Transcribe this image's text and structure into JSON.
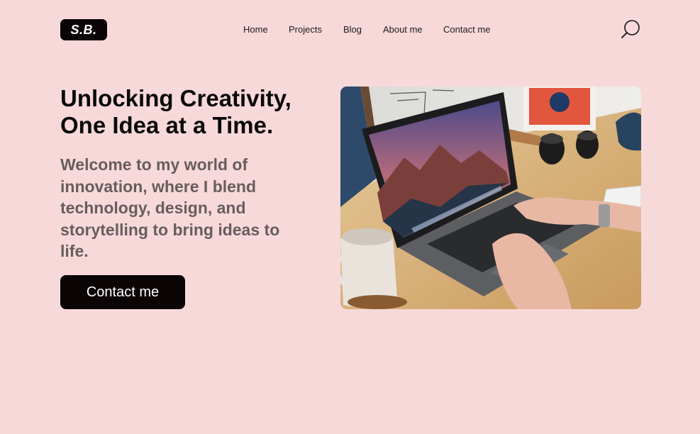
{
  "brand": {
    "logo": "S.B."
  },
  "nav": {
    "items": [
      {
        "label": "Home"
      },
      {
        "label": "Projects"
      },
      {
        "label": "Blog"
      },
      {
        "label": "About me"
      },
      {
        "label": "Contact me"
      }
    ]
  },
  "hero": {
    "headline": "Unlocking Creativity, One Idea at a Time.",
    "intro": "Welcome to my world of innovation, where I blend technology, design, and storytelling to bring ideas to life.",
    "cta_label": "Contact me"
  },
  "icons": {
    "search": "search-icon"
  },
  "colors": {
    "background": "#f8d9da",
    "button": "#0b0405",
    "intro_text": "#675d5e"
  }
}
